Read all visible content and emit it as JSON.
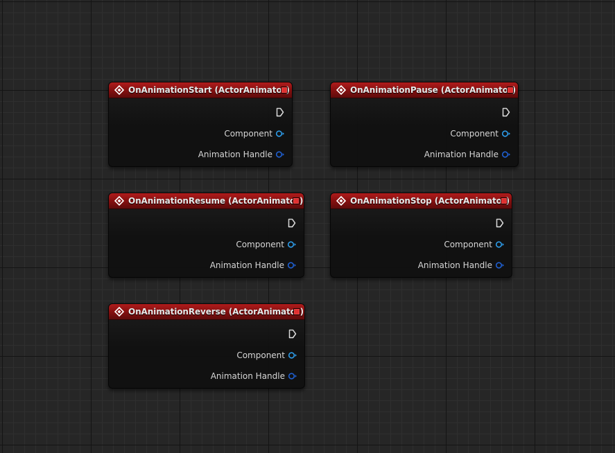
{
  "graph": {
    "nodes": [
      {
        "title": "OnAnimationStart (ActorAnimator)",
        "pins": [
          "Component",
          "Animation Handle"
        ]
      },
      {
        "title": "OnAnimationPause (ActorAnimator)",
        "pins": [
          "Component",
          "Animation Handle"
        ]
      },
      {
        "title": "OnAnimationResume (ActorAnimator)",
        "pins": [
          "Component",
          "Animation Handle"
        ]
      },
      {
        "title": "OnAnimationStop (ActorAnimator)",
        "pins": [
          "Component",
          "Animation Handle"
        ]
      },
      {
        "title": "OnAnimationReverse (ActorAnimator)",
        "pins": [
          "Component",
          "Animation Handle"
        ]
      }
    ]
  },
  "colors": {
    "header": "#8a1111",
    "delegate_pin": "#e03030",
    "object_pin": "#2d9be8",
    "struct_pin": "#1f5fd0",
    "exec_pin": "#ffffff"
  },
  "icons": {
    "node_icon": "event-diamond-icon",
    "delegate_icon": "delegate-pin-icon",
    "exec_icon": "exec-output-pin-icon",
    "data_icon": "data-output-pin-icon"
  }
}
